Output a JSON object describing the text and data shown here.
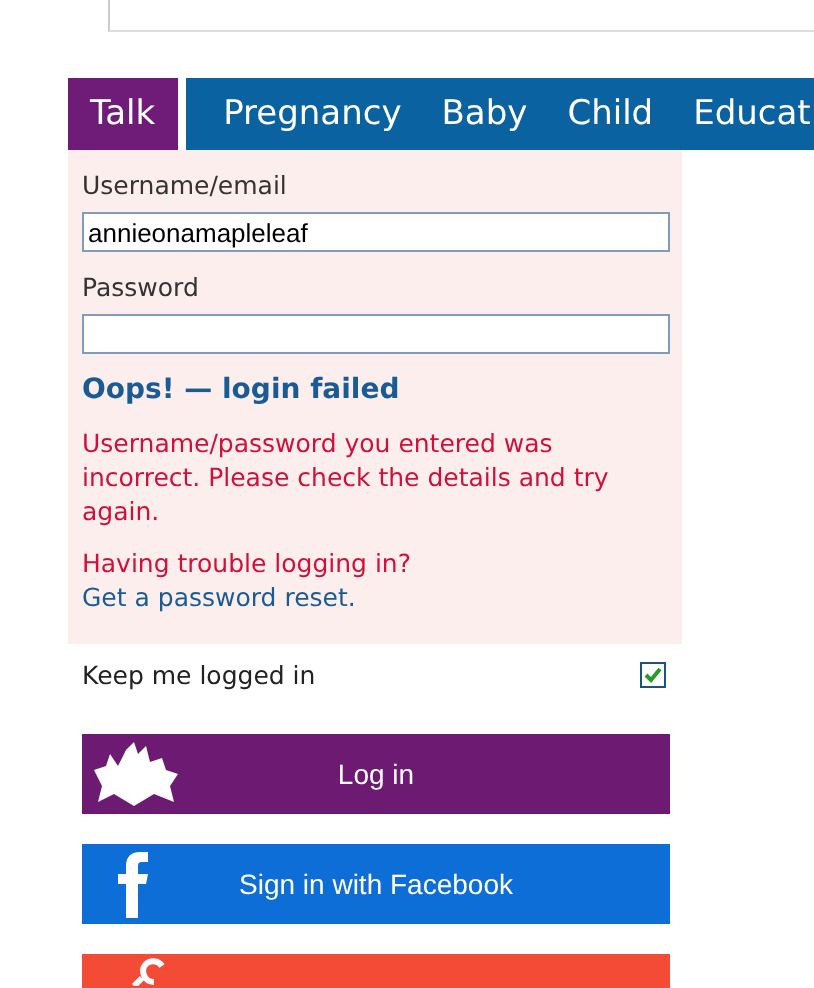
{
  "tabs": [
    {
      "label": "Talk",
      "selected": true
    },
    {
      "label": "Pregnancy",
      "selected": false
    },
    {
      "label": "Baby",
      "selected": false
    },
    {
      "label": "Child",
      "selected": false
    },
    {
      "label": "Educat",
      "selected": false
    }
  ],
  "login": {
    "username_label": "Username/email",
    "username_value": "annieonamapleleaf",
    "password_label": "Password",
    "error_title": "Oops! — login failed",
    "error_message": "Username/password you entered was incorrect. Please check the details and try again.",
    "trouble_text": "Having trouble logging in?",
    "reset_link": "Get a password reset",
    "reset_end": "."
  },
  "keep_logged_in": {
    "label": "Keep me logged in",
    "checked": true
  },
  "buttons": [
    {
      "kind": "login",
      "label": "Log in"
    },
    {
      "kind": "facebook",
      "label": "Sign in with Facebook"
    },
    {
      "kind": "google"
    }
  ]
}
